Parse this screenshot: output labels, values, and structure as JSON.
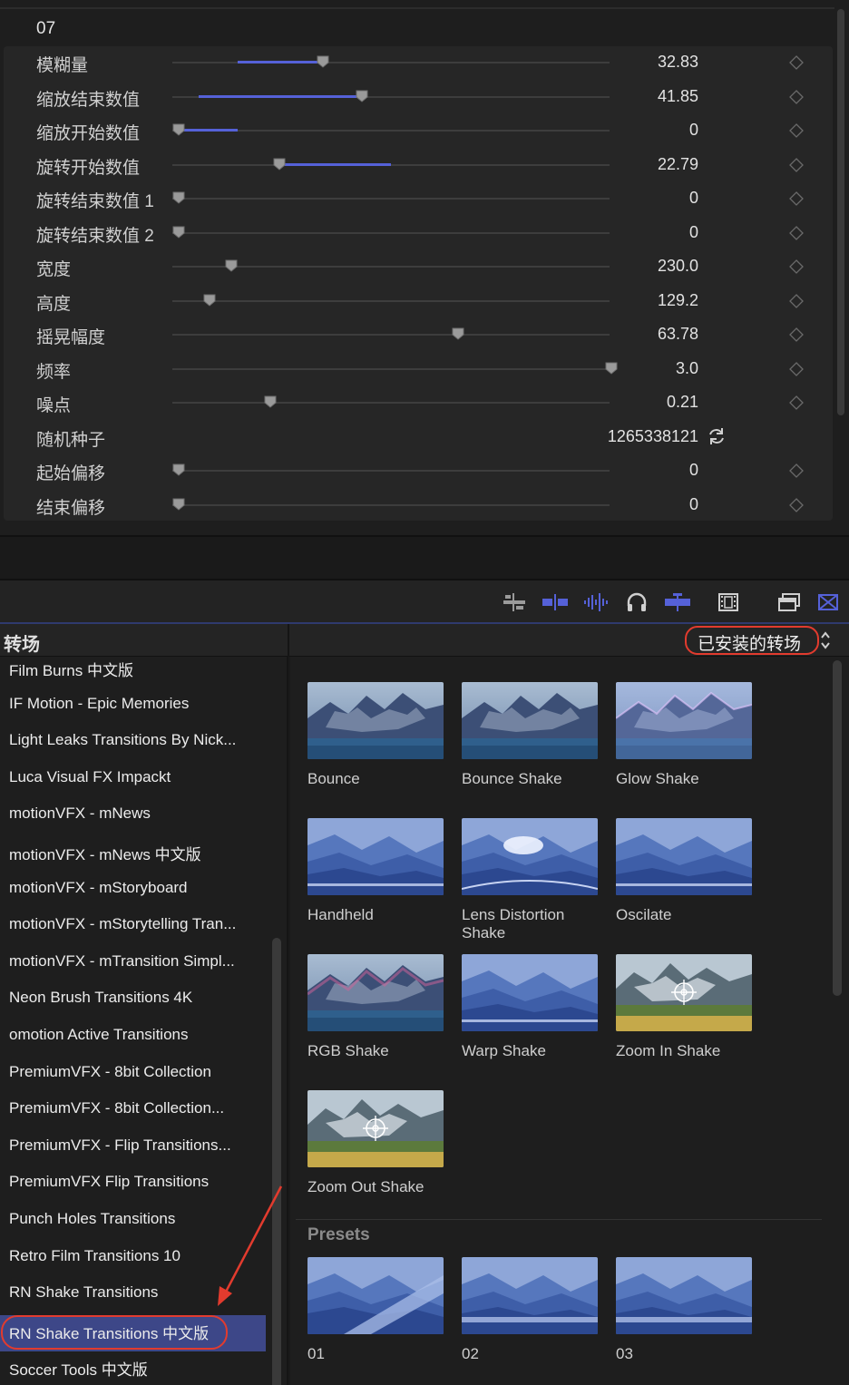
{
  "inspector": {
    "group_title": "07",
    "params": [
      {
        "label": "模糊量",
        "value": "32.83",
        "level": 0.33,
        "fill_from": 0.15
      },
      {
        "label": "缩放结束数值",
        "value": "41.85",
        "level": 0.42,
        "fill_from": 0.06
      },
      {
        "label": "缩放开始数值",
        "value": "0",
        "level": 0.0,
        "fill_to": 0.15
      },
      {
        "label": "旋转开始数值",
        "value": "22.79",
        "level": 0.23,
        "fill_to": 0.5
      },
      {
        "label": "旋转结束数值 1",
        "value": "0",
        "level": 0.0
      },
      {
        "label": "旋转结束数值 2",
        "value": "0",
        "level": 0.0
      },
      {
        "label": "宽度",
        "value": "230.0",
        "level": 0.12
      },
      {
        "label": "高度",
        "value": "129.2",
        "level": 0.07
      },
      {
        "label": "摇晃幅度",
        "value": "63.78",
        "level": 0.64
      },
      {
        "label": "频率",
        "value": "3.0",
        "level": 0.99
      },
      {
        "label": "噪点",
        "value": "0.21",
        "level": 0.21
      },
      {
        "label": "随机种子",
        "value": "1265338121",
        "type": "seed"
      },
      {
        "label": "起始偏移",
        "value": "0",
        "level": 0.0
      },
      {
        "label": "结束偏移",
        "value": "0",
        "level": 0.0
      }
    ]
  },
  "toolbar": {
    "icons": [
      "trim-icon",
      "marker-icon",
      "audio-waveform-icon",
      "headphones-icon",
      "snapping-icon",
      "filmstrip-icon",
      "window-icon",
      "transitions-icon"
    ],
    "accent": "#5561d8"
  },
  "browser": {
    "title": "转场",
    "filter_label": "已安装的转场"
  },
  "sidebar": {
    "items": [
      "Film Burns 中文版",
      "IF Motion - Epic Memories",
      "Light Leaks Transitions By Nick...",
      "Luca Visual FX Impackt",
      "motionVFX - mNews",
      "motionVFX - mNews 中文版",
      "motionVFX - mStoryboard",
      "motionVFX - mStorytelling Tran...",
      "motionVFX - mTransition Simpl...",
      "Neon Brush Transitions 4K",
      "omotion Active Transitions",
      "PremiumVFX - 8bit Collection",
      "PremiumVFX - 8bit Collection...",
      "PremiumVFX - Flip Transitions...",
      "PremiumVFX Flip Transitions",
      "Punch Holes Transitions",
      "Retro Film Transitions 10",
      "RN Shake Transitions",
      "RN Shake Transitions 中文版",
      "Soccer Tools 中文版"
    ],
    "selected_index": 18,
    "highlight_color": "#e23b2e"
  },
  "grid": {
    "tiles": [
      {
        "name": "Bounce",
        "thumb": "mountain"
      },
      {
        "name": "Bounce Shake",
        "thumb": "mountain"
      },
      {
        "name": "Glow Shake",
        "thumb": "mountain-glow"
      },
      {
        "name": "Handheld",
        "thumb": "blue"
      },
      {
        "name": "Lens Distortion Shake",
        "thumb": "blue-lens"
      },
      {
        "name": "Oscilate",
        "thumb": "blue"
      },
      {
        "name": "RGB Shake",
        "thumb": "mountain-rgb"
      },
      {
        "name": "Warp Shake",
        "thumb": "blue"
      },
      {
        "name": "Zoom In Shake",
        "thumb": "field"
      },
      {
        "name": "Zoom Out Shake",
        "thumb": "field"
      }
    ],
    "presets_title": "Presets",
    "presets": [
      {
        "name": "01",
        "thumb": "blue-diag"
      },
      {
        "name": "02",
        "thumb": "blue-stripe"
      },
      {
        "name": "03",
        "thumb": "blue-stripe"
      }
    ]
  }
}
